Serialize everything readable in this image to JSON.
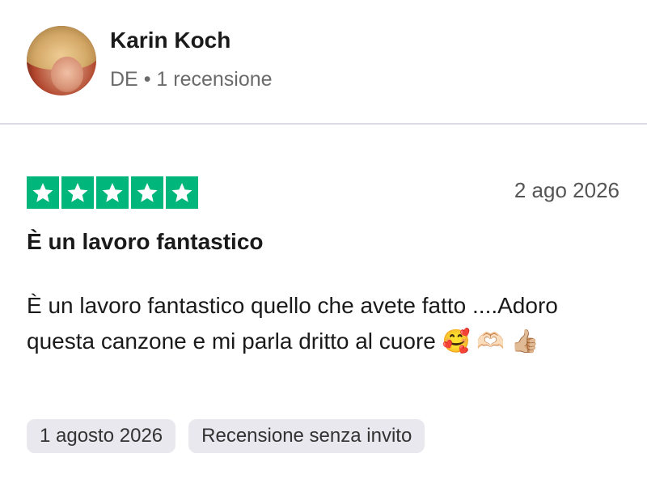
{
  "reviewer": {
    "name": "Karin Koch",
    "country": "DE",
    "separator": "•",
    "review_count": "1 recensione"
  },
  "review": {
    "rating": 5,
    "rating_color": "#00b67a",
    "date": "2 ago 2026",
    "title": "È un lavoro fantastico",
    "body": "È un lavoro fantastico quello che avete fatto ....Adoro questa canzone e mi parla dritto al cuore 🥰 🫶🏻 👍🏼"
  },
  "tags": {
    "experience_date": "1 agosto 2026",
    "invite_status": "Recensione senza invito"
  },
  "icons": {
    "avatar": "user-avatar-photo",
    "star": "star-icon"
  }
}
